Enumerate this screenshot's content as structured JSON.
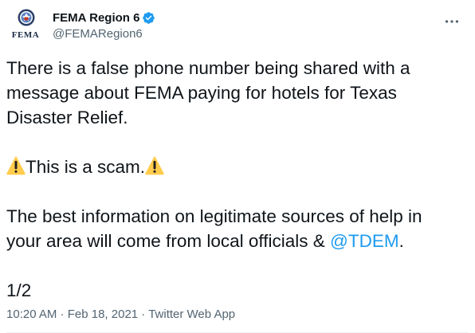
{
  "author": {
    "display_name": "FEMA Region 6",
    "handle": "@FEMARegion6",
    "avatar_text": "FEMA",
    "verified": true,
    "verified_color": "#1d9bf0"
  },
  "tweet": {
    "paragraph1": "There is a false phone number being shared with a message about FEMA paying for hotels for Texas Disaster Relief.",
    "scam_text": "This is a scam.",
    "paragraph3_prefix": "The best information on legitimate sources of help in your area will come from local officials & ",
    "mention": "@TDEM",
    "paragraph3_suffix": ".",
    "thread_counter": "1/2"
  },
  "meta": {
    "time": "10:20 AM",
    "separator1": " · ",
    "date": "Feb 18, 2021",
    "separator2": " · ",
    "source": "Twitter Web App"
  },
  "icons": {
    "warning": "warning-icon",
    "verified": "verified-badge-icon",
    "more": "more-options-icon"
  },
  "colors": {
    "text": "#0f1419",
    "secondary": "#536471",
    "link": "#1d9bf0"
  }
}
